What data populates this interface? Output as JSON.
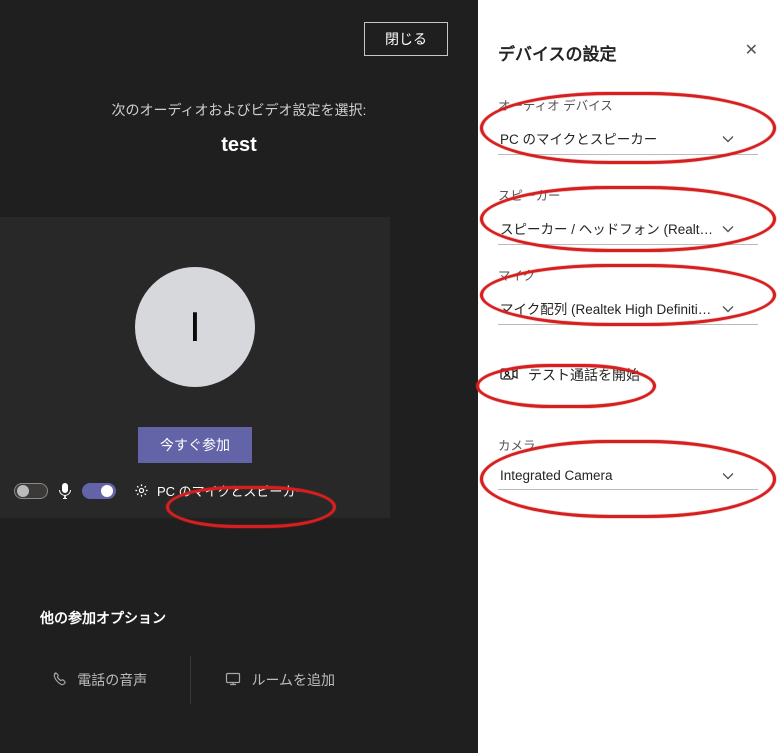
{
  "left": {
    "close_label": "閉じる",
    "instruction": "次のオーディオおよびビデオ設定を選択:",
    "meeting_name": "test",
    "avatar_initial": "I",
    "join_label": "今すぐ参加",
    "audio_device_label": "PC のマイクとスピーカー",
    "other_options_heading": "他の参加オプション",
    "phone_audio_label": "電話の音声",
    "add_room_label": "ルームを追加"
  },
  "right": {
    "title": "デバイスの設定",
    "audio_device": {
      "label": "オーディオ デバイス",
      "value": "PC のマイクとスピーカー"
    },
    "speaker": {
      "label": "スピーカー",
      "value": "スピーカー / ヘッドフォン (Realtek High De..."
    },
    "mic": {
      "label": "マイク",
      "value": "マイク配列 (Realtek High Definition A..."
    },
    "test_call_label": "テスト通話を開始",
    "camera": {
      "label": "カメラ",
      "value": "Integrated Camera"
    }
  }
}
